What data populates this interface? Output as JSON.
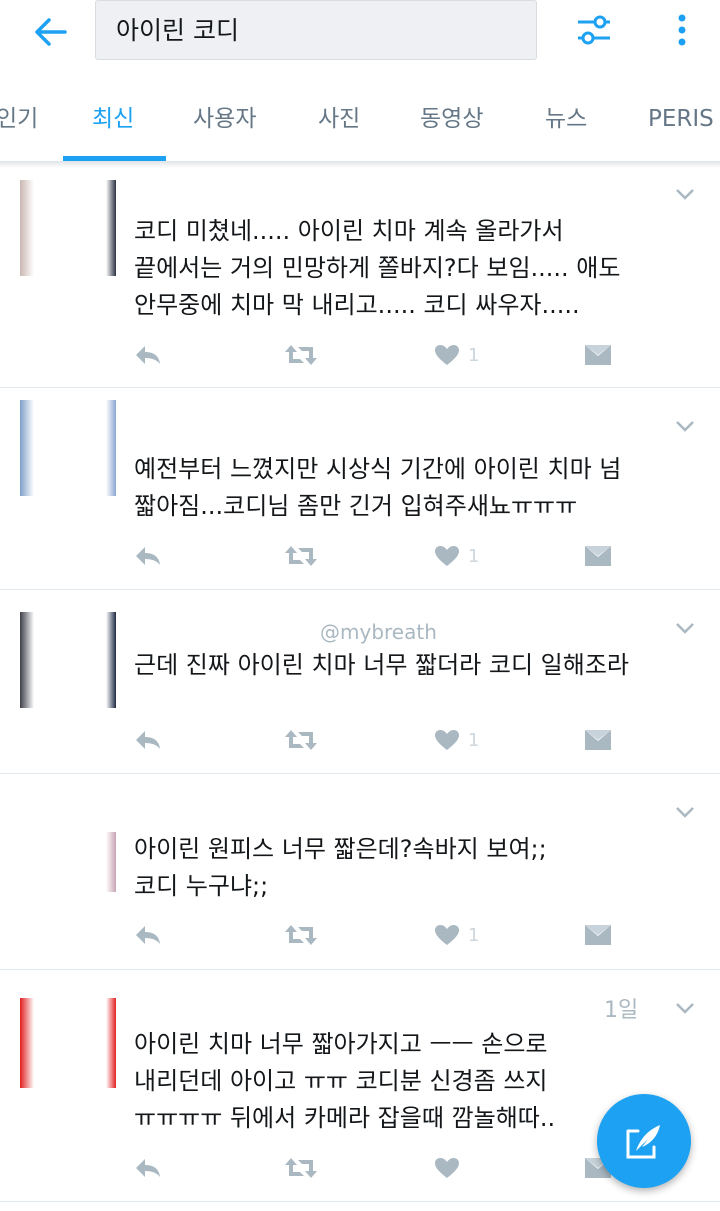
{
  "search": {
    "query": "아이린 코디"
  },
  "icons": {
    "back": "arrow-left-icon",
    "filter": "sliders-icon",
    "more": "more-vertical-icon",
    "chevron": "chevron-down-icon",
    "reply": "reply-icon",
    "retweet": "retweet-icon",
    "like": "heart-icon",
    "dm": "direct-message-icon",
    "compose": "compose-tweet-icon"
  },
  "colors": {
    "accent": "#1da1f2",
    "muted": "#ccd6dd",
    "text": "#14171a"
  },
  "tabs": [
    {
      "label": "인기"
    },
    {
      "label": "최신",
      "active": true
    },
    {
      "label": "사용자"
    },
    {
      "label": "사진"
    },
    {
      "label": "동영상"
    },
    {
      "label": "뉴스"
    },
    {
      "label": "PERIS"
    }
  ],
  "tweets": [
    {
      "header": "",
      "text": "코디 미쳤네..... 아이린 치마 계속 올라가서\n끝에서는 거의 민망하게 쫄바지?다 보임..... 애도\n안무중에 치마 막 내리고..... 코디 싸우자.....",
      "likes": "1"
    },
    {
      "header": "",
      "text": "예전부터 느꼈지만 시상식 기간에 아이린 치마 넘\n짧아짐...코디님 좀만 긴거 입혀주새뇨ㅠㅠㅠ",
      "likes": "1"
    },
    {
      "header": "@mybreath",
      "text": "근데 진짜 아이린 치마 너무 짧더라 코디 일해조라",
      "likes": "1"
    },
    {
      "header": "",
      "text": "아이린 원피스 너무 짧은데?속바지 보여;;\n코디 누구냐;;",
      "likes": "1"
    },
    {
      "header": "1일",
      "text": "아이린 치마 너무 짧아가지고 ㅡㅡ 손으로\n내리던데 아이고 ㅠㅠ 코디분 신경좀 쓰지\nㅠㅠㅠㅠ 뒤에서 카메라 잡을때 깜놀해따..",
      "likes": ""
    }
  ]
}
